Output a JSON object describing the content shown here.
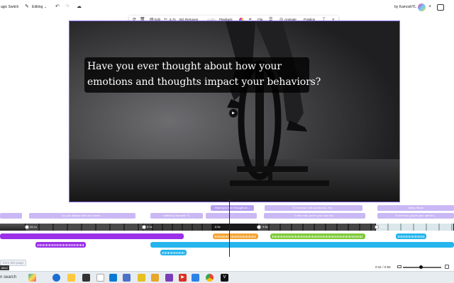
{
  "topbar": {
    "magic_switch": "agic Switch",
    "editing": "Editing",
    "owner": "by KamoshTL",
    "avatar_initials": "K"
  },
  "toolbar": {
    "edit": "Edit",
    "speed": "5.7s",
    "bg_remover": "BG Remover",
    "audio": "Audio",
    "playback": "Playback",
    "flip": "Flip",
    "animate": "Animate",
    "position": "Position"
  },
  "canvas": {
    "caption_line1": "Have you ever thought about how your",
    "caption_line2": "emotions and thoughts impact your behaviors?"
  },
  "timeline": {
    "caption_clips_top": [
      {
        "label": "Have you ever thought ab..."
      },
      {
        "label": "To increase self-awareness, the..."
      },
      {
        "label": "Avery Stads"
      }
    ],
    "caption_clips_bottom": [
      {
        "label": ""
      },
      {
        "label": "Do you always start and contin..."
      },
      {
        "label": "edited by Kamosh TL"
      },
      {
        "label": ""
      },
      {
        "label": "To the end, you're your own bo..."
      }
    ],
    "strip_labels": [
      "28.1s",
      "9.0s",
      "6.5s",
      "9.6s",
      "8.1s"
    ]
  },
  "footer": {
    "time": "0:31 / 0:55",
    "note_chip": "from this page",
    "note_chip2": "ation"
  },
  "taskbar": {
    "search": "n search"
  },
  "colors": {
    "accent_purple": "#8b6cf0",
    "audio_purple": "#9b30e8",
    "audio_cyan": "#25b5ee",
    "audio_orange": "#f3a536",
    "audio_green": "#7ecb3a"
  }
}
